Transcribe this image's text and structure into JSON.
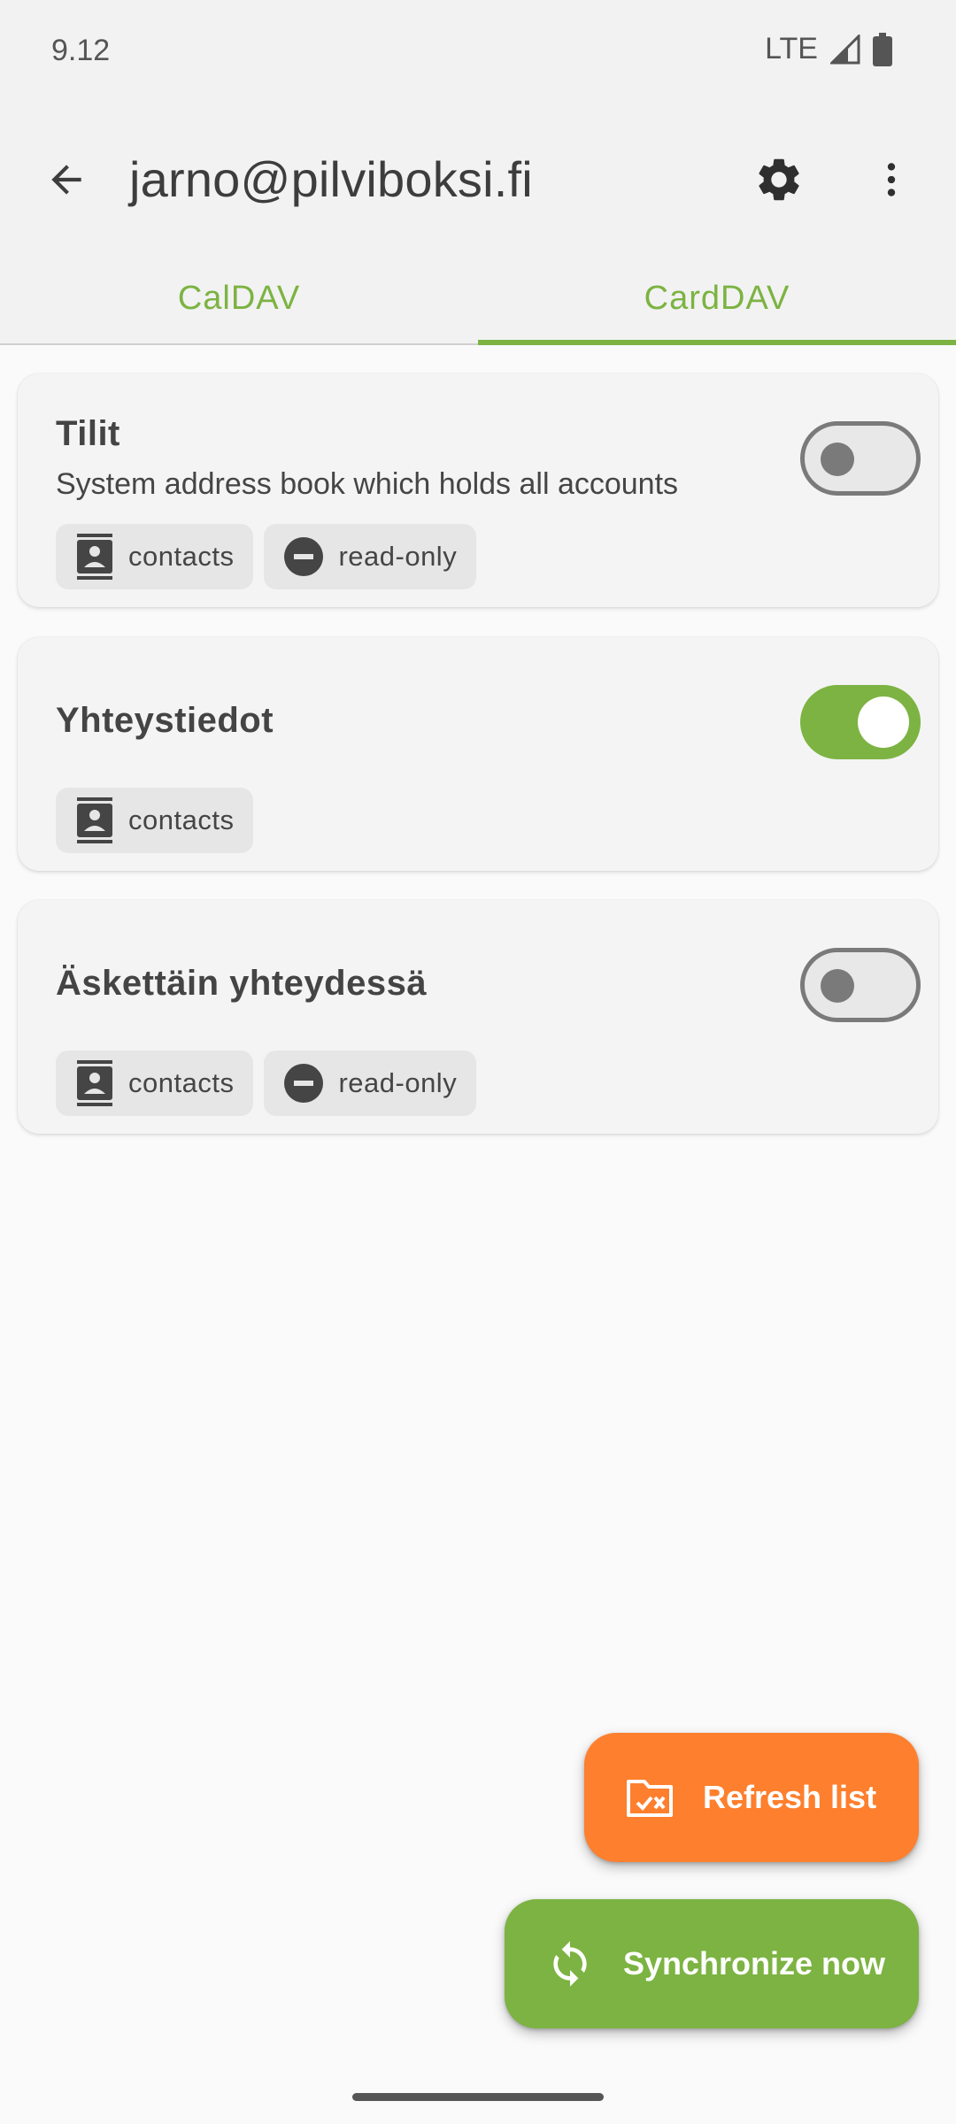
{
  "status_bar": {
    "time": "9.12",
    "network": "LTE"
  },
  "app_bar": {
    "title": "jarno@pilviboksi.fi"
  },
  "tabs": [
    {
      "label": "CalDAV",
      "active": false
    },
    {
      "label": "CardDAV",
      "active": true
    }
  ],
  "colors": {
    "accent": "#7cb342",
    "refresh_fab": "#fe7f2d"
  },
  "address_books": [
    {
      "title": "Tilit",
      "description": "System address book which holds all accounts",
      "enabled": false,
      "chips": {
        "type": "contacts",
        "access": "read-only"
      }
    },
    {
      "title": "Yhteystiedot",
      "enabled": true,
      "chips": {
        "type": "contacts"
      }
    },
    {
      "title": "Äskettäin yhteydessä",
      "enabled": false,
      "chips": {
        "type": "contacts",
        "access": "read-only"
      }
    }
  ],
  "fabs": {
    "refresh_label": "Refresh list",
    "sync_label": "Synchronize now"
  }
}
